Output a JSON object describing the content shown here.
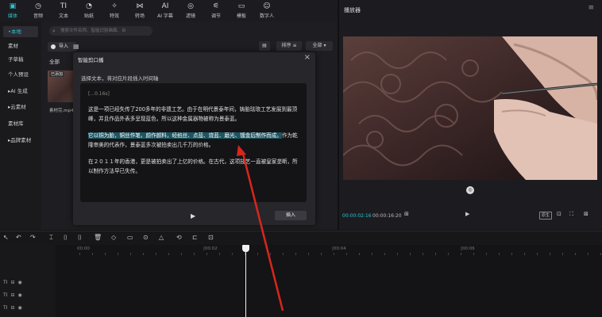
{
  "toolbar": {
    "tools": [
      {
        "icon": "media-icon",
        "glyph": "▣",
        "label": "媒体",
        "active": true
      },
      {
        "icon": "audio-icon",
        "glyph": "◷",
        "label": "音频"
      },
      {
        "icon": "text-icon",
        "glyph": "TI",
        "label": "文本"
      },
      {
        "icon": "sticker-icon",
        "glyph": "◔",
        "label": "贴纸"
      },
      {
        "icon": "effects-icon",
        "glyph": "✧",
        "label": "特效"
      },
      {
        "icon": "transition-icon",
        "glyph": "⋈",
        "label": "转场"
      },
      {
        "icon": "ai-subtitle-icon",
        "glyph": "AI",
        "label": "AI 字幕"
      },
      {
        "icon": "filter-icon",
        "glyph": "◎",
        "label": "滤镜"
      },
      {
        "icon": "adjust-icon",
        "glyph": "⚟",
        "label": "调节"
      },
      {
        "icon": "template-icon",
        "glyph": "▭",
        "label": "模板"
      },
      {
        "icon": "digital-human-icon",
        "glyph": "☺",
        "label": "数字人"
      }
    ]
  },
  "sidebar": {
    "items": [
      {
        "label": "•本地",
        "active": true
      },
      {
        "label": "素材"
      },
      {
        "label": "子草稿"
      },
      {
        "label": "个人预设"
      },
      {
        "label": "▸AI 生成"
      },
      {
        "label": "▸云素材"
      },
      {
        "label": "素材库"
      },
      {
        "label": "▸品牌素材"
      }
    ]
  },
  "media": {
    "search_placeholder": "搜索文件名称、智能识别画面、台",
    "import_label": "导入",
    "sort_label": "排序",
    "all_label": "全部",
    "tab_all": "全部",
    "thumb_tag": "已添加",
    "thumb_name": "素材完.mp4"
  },
  "dialog": {
    "title": "智能剪口播",
    "close": "×",
    "prompt": "选择文本，将对应片段插入时间轴",
    "time": "[...0.16s]",
    "para1": "这是一项已经失传了200多年的非遗工艺。由于在明代景泰年间，铸胎珐琅工艺发展到最顶峰，并且作品外表多呈现蓝色，所以这种金属器物被称为景泰蓝。",
    "para2_hl1": "它以铜为胎，铜丝作笔，颜作颜料，经掐丝、点蓝、烧蓝、磨光、镀金后制作而",
    "para2_hl2": "成。",
    "para2_rest": "作为乾隆审美的代表作，景泰蓝多次被拍卖出几千万的价格。",
    "para3": "在２０１１年的香港，更是被拍卖出了上亿的价格。在古代，这项技艺一直被皇家垄断，所以制作方法早已失传。",
    "insert_label": "插入"
  },
  "player": {
    "title": "播放器",
    "current_time": "00:00:02:16",
    "total_time": "00:00:16:20",
    "ratio_label": "原生"
  },
  "timeline": {
    "ruler": [
      "00:00",
      "|00:02",
      "|00:04",
      "|00:06"
    ],
    "rows": [
      "TI",
      "TI",
      "TI"
    ]
  },
  "colors": {
    "accent": "#27c4d6",
    "highlight": "#1c5563",
    "arrow": "#d9261c"
  }
}
